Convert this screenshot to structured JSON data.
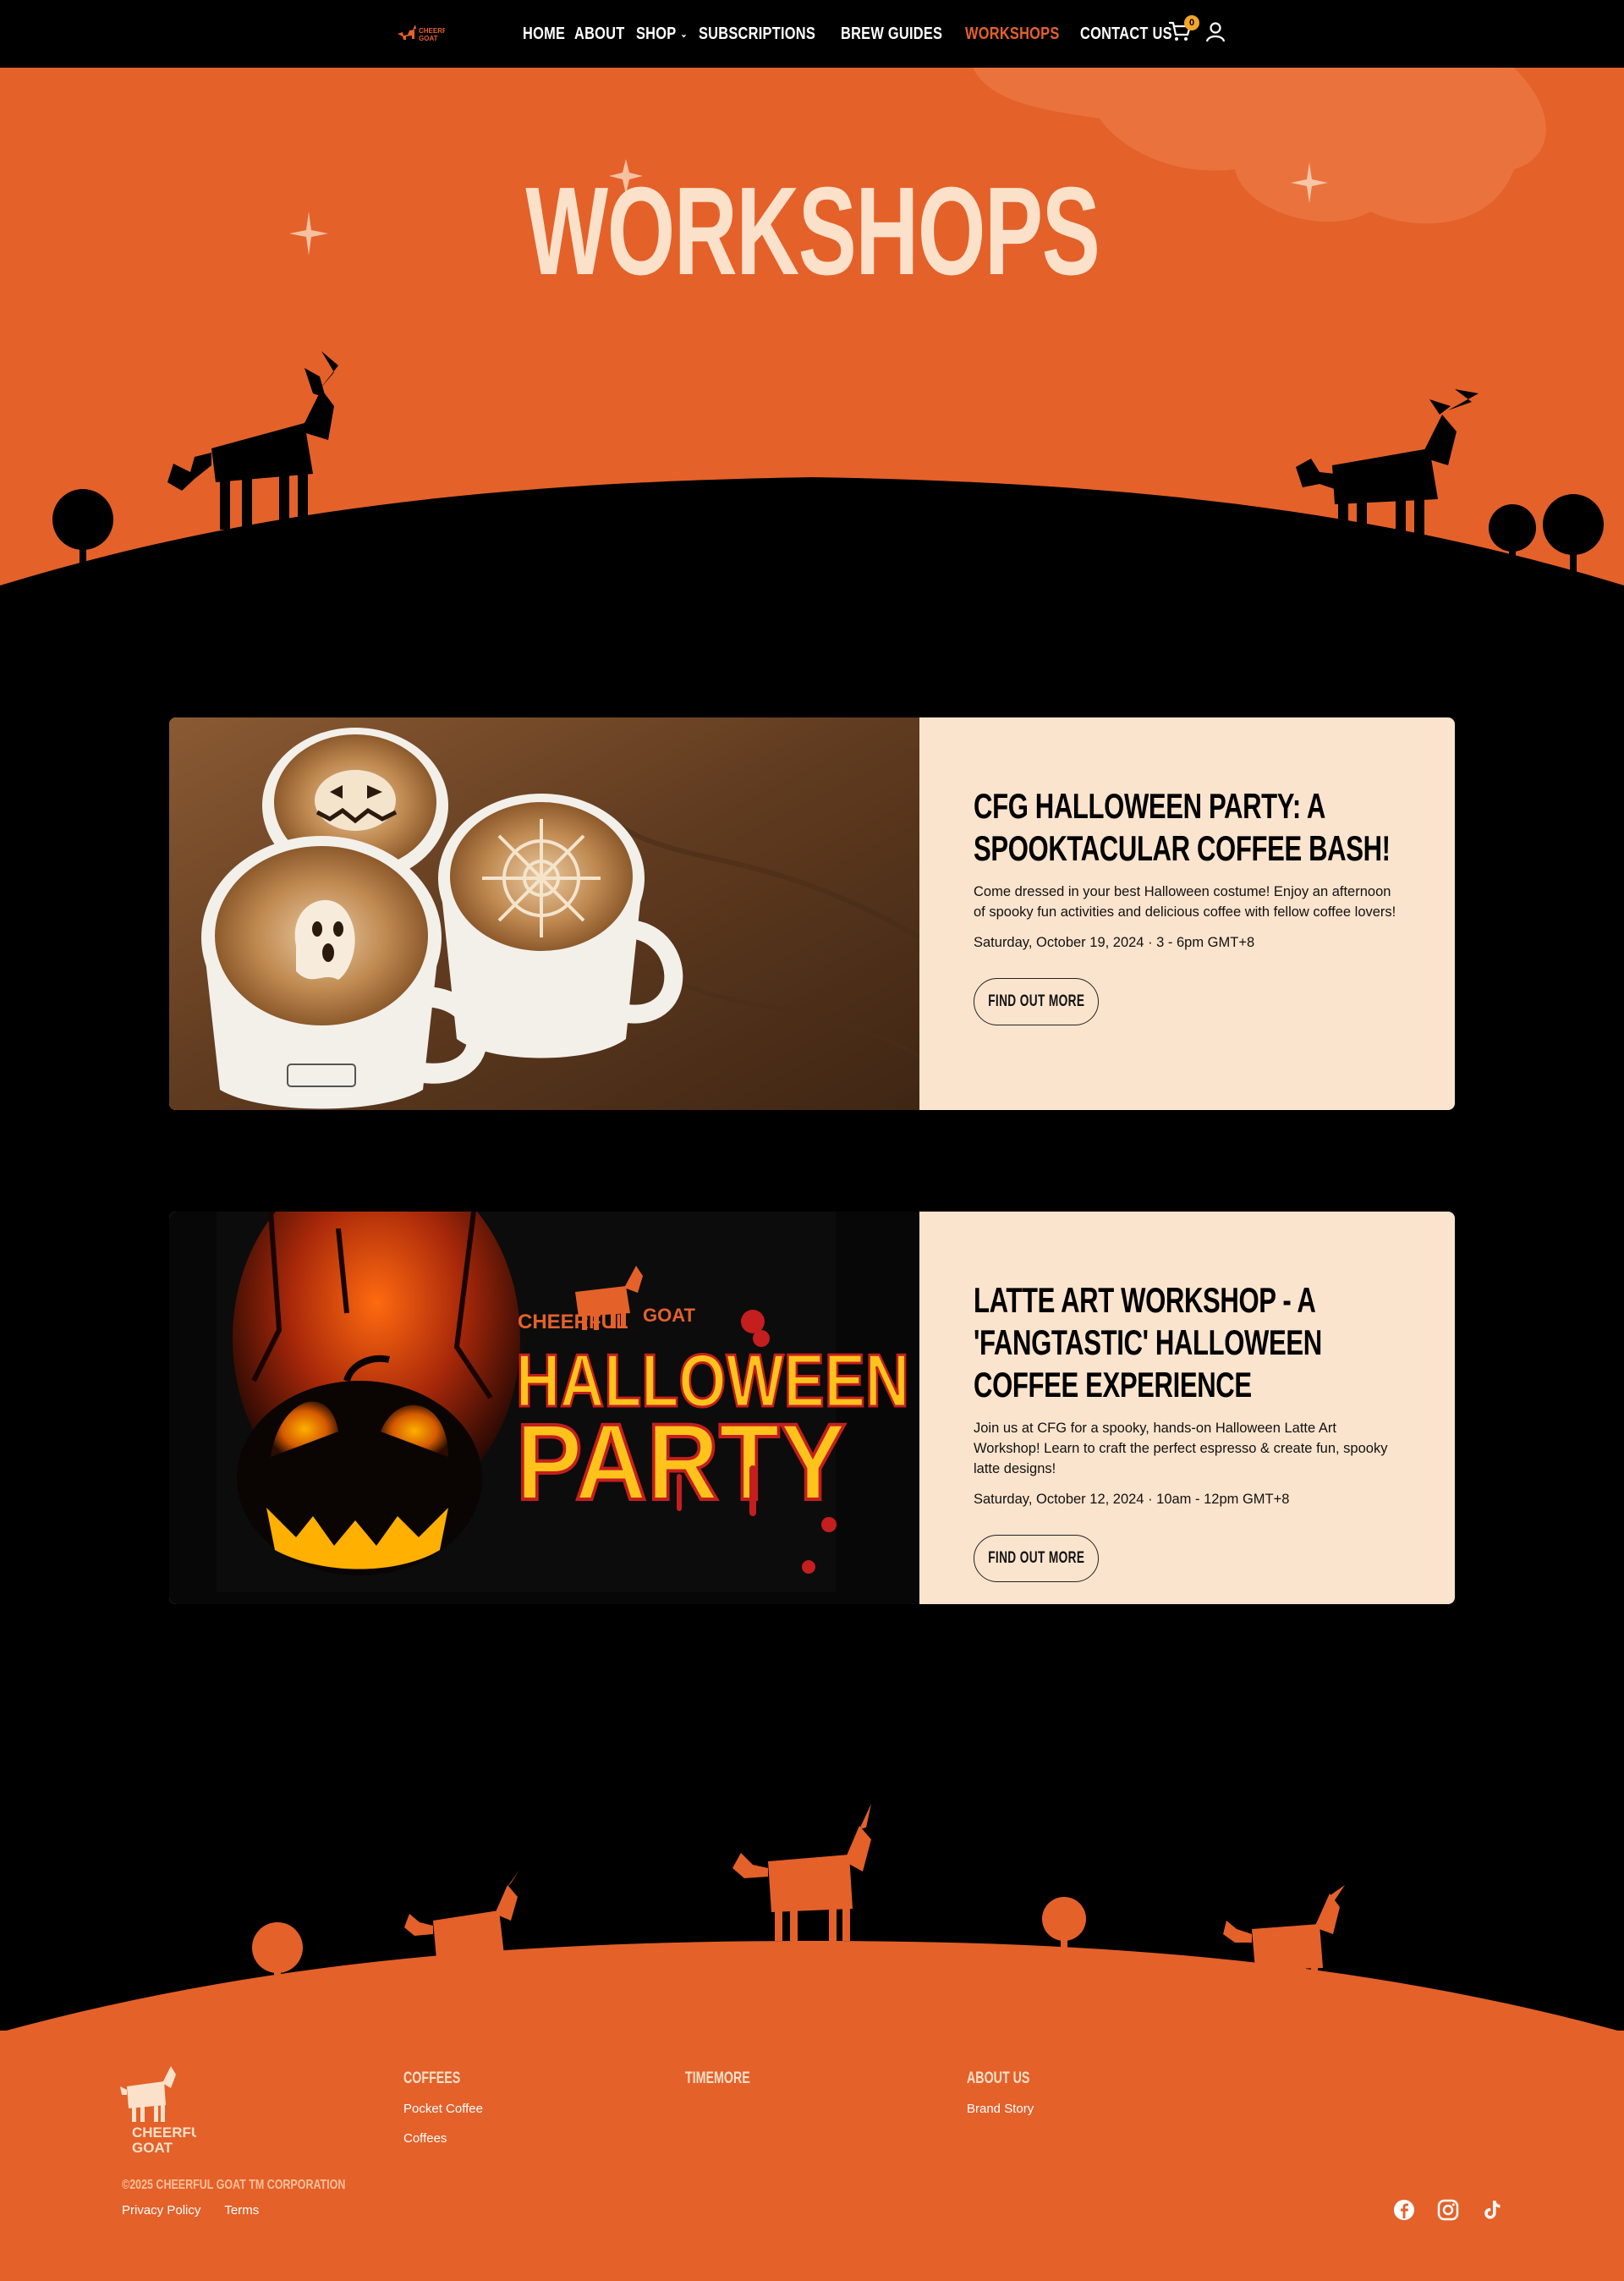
{
  "colors": {
    "brand": "#e4612a",
    "cream": "#fbe4cd",
    "black": "#000000",
    "cartBadge": "#f4a52a"
  },
  "nav": {
    "links": [
      {
        "label": "HOME"
      },
      {
        "label": "ABOUT"
      },
      {
        "label": "SHOP"
      },
      {
        "label": "SUBSCRIPTIONS"
      },
      {
        "label": "BREW GUIDES"
      },
      {
        "label": "WORKSHOPS"
      },
      {
        "label": "CONTACT US"
      }
    ],
    "cart_count": "0",
    "logo_text": [
      "CHEERFUL",
      "GOAT"
    ]
  },
  "hero": {
    "title": "WORKSHOPS"
  },
  "workshops": [
    {
      "title": "CFG Halloween Party: A Spooktacular Coffee Bash!",
      "description": "Come dressed in your best Halloween costume! Enjoy an afternoon of spooky fun activities and delicious coffee with fellow coffee lovers!",
      "date": "Saturday, October 19, 2024 · 3 - 6pm GMT+8",
      "button": "FIND OUT MORE"
    },
    {
      "title": "Latte Art Workshop - A 'Fangtastic' Halloween Coffee Experience",
      "description": "Join us at CFG for a spooky, hands-on Halloween Latte Art Workshop! Learn to craft the perfect espresso & create fun, spooky latte designs!",
      "date": "Saturday, October 12, 2024 · 10am - 12pm GMT+8",
      "button": "FIND OUT MORE",
      "image_text": {
        "brand": "CHEERFUL",
        "brand2": "GOAT",
        "line1": "HALLOWEEN",
        "line2": "PARTY"
      }
    }
  ],
  "footer": {
    "logo_text": [
      "CHEERFUL",
      "GOAT"
    ],
    "columns": [
      {
        "title": "COFFEES",
        "links": [
          "Pocket Coffee",
          "Coffees"
        ]
      },
      {
        "title": "TIMEMORE",
        "links": []
      },
      {
        "title": "ABOUT US",
        "links": [
          "Brand Story"
        ]
      }
    ],
    "copyright": "©2025 CHEERFUL GOAT TM CORPORATION",
    "legal": [
      "Privacy Policy",
      "Terms"
    ],
    "socials": [
      "facebook-icon",
      "instagram-icon",
      "tiktok-icon"
    ]
  }
}
